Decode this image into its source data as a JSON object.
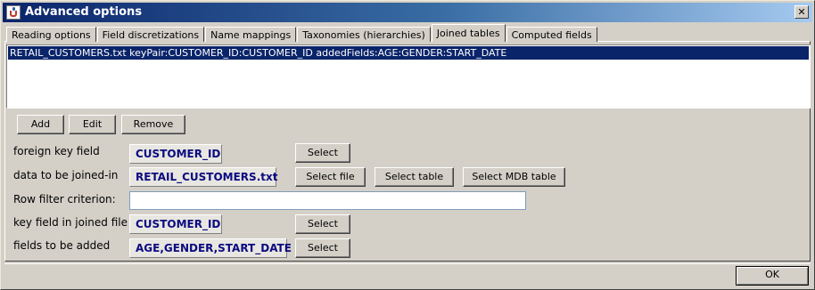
{
  "window": {
    "title": "Advanced options",
    "close_glyph": "✕",
    "icon": "java-cup-icon"
  },
  "tabs": [
    {
      "label": "Reading options",
      "active": false
    },
    {
      "label": "Field discretizations",
      "active": false
    },
    {
      "label": "Name mappings",
      "active": false
    },
    {
      "label": "Taxonomies (hierarchies)",
      "active": false
    },
    {
      "label": "Joined tables",
      "active": true
    },
    {
      "label": "Computed fields",
      "active": false
    }
  ],
  "joined_list": {
    "items": [
      "RETAIL_CUSTOMERS.txt keyPair:CUSTOMER_ID:CUSTOMER_ID addedFields:AGE:GENDER:START_DATE"
    ],
    "selected_index": 0
  },
  "list_actions": {
    "add": "Add",
    "edit": "Edit",
    "remove": "Remove"
  },
  "form": {
    "foreign_key": {
      "label": "foreign key field",
      "value": "CUSTOMER_ID",
      "select": "Select"
    },
    "data_joined": {
      "label": "data to be joined-in",
      "value": "RETAIL_CUSTOMERS.txt",
      "select_file": "Select file",
      "select_table": "Select table",
      "select_mdb": "Select MDB table"
    },
    "row_filter": {
      "label": "Row filter criterion:",
      "value": "",
      "placeholder": ""
    },
    "key_field": {
      "label": "key field in joined file",
      "value": "CUSTOMER_ID",
      "select": "Select"
    },
    "fields_added": {
      "label": "fields to be added",
      "value": "AGE,GENDER,START_DATE",
      "select": "Select"
    }
  },
  "footer": {
    "ok": "OK"
  },
  "colors": {
    "selection": "#0a246a",
    "value_text": "#0a0a80",
    "face": "#d4d0c8"
  }
}
